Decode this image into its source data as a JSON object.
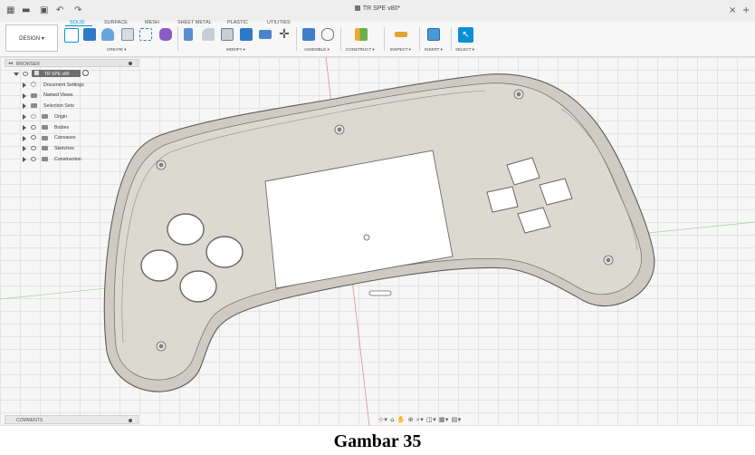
{
  "titlebar": {
    "grid_icon": "▦",
    "file_icon": "▬",
    "save_icon": "▣",
    "undo_icon": "↶",
    "redo_icon": "↷",
    "doc_title": "TR SPE v80*",
    "close_icon": "×",
    "add_icon": "+"
  },
  "workspace": {
    "label": "DESIGN ▾"
  },
  "tabs": [
    "SOLID",
    "SURFACE",
    "MESH",
    "SHEET METAL",
    "PLASTIC",
    "UTILITIES"
  ],
  "groups": [
    "CREATE ▾",
    "MODIFY ▾",
    "ASSEMBLE ▾",
    "CONSTRUCT ▾",
    "INSPECT ▾",
    "INSERT ▾",
    "SELECT ▾"
  ],
  "browser": {
    "title": "BROWSER",
    "root": "TR SPE v80",
    "items": [
      "Document Settings",
      "Named Views",
      "Selection Sets",
      "Origin",
      "Bodies",
      "Canvases",
      "Sketches",
      "Construction"
    ]
  },
  "comments": {
    "title": "COMMENTS"
  },
  "navbar": {
    "icons": "⊹▾ ⌂ ✋ ⊕ ⌕▾ ◫▾ ▦▾ ▤▾"
  },
  "colors": {
    "accent": "#0696d7",
    "model_face": "#d9d6cf",
    "model_edge": "#6f6f6f"
  },
  "caption": "Gambar 35"
}
